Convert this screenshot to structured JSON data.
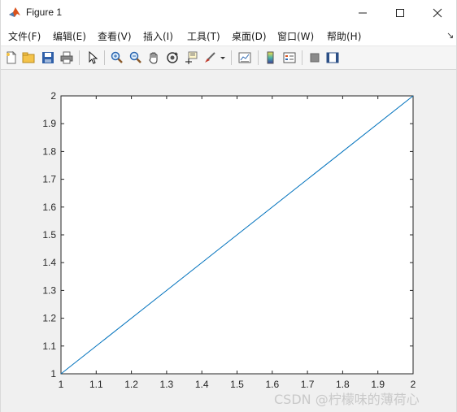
{
  "window": {
    "title": "Figure 1"
  },
  "menubar": {
    "items": [
      {
        "label": "文件(F)"
      },
      {
        "label": "编辑(E)"
      },
      {
        "label": "查看(V)"
      },
      {
        "label": "插入(I)"
      },
      {
        "label": "工具(T)"
      },
      {
        "label": "桌面(D)"
      },
      {
        "label": "窗口(W)"
      },
      {
        "label": "帮助(H)"
      }
    ]
  },
  "toolbar": {
    "buttons": [
      {
        "icon": "new-figure-icon"
      },
      {
        "icon": "open-file-icon"
      },
      {
        "icon": "save-icon"
      },
      {
        "icon": "print-icon"
      },
      {
        "icon": "edit-plot-arrow-icon"
      },
      {
        "icon": "zoom-in-icon"
      },
      {
        "icon": "zoom-out-icon"
      },
      {
        "icon": "pan-hand-icon"
      },
      {
        "icon": "rotate-3d-icon"
      },
      {
        "icon": "data-cursor-icon"
      },
      {
        "icon": "brush-icon"
      },
      {
        "icon": "link-plot-icon"
      },
      {
        "icon": "colorbar-icon"
      },
      {
        "icon": "legend-icon"
      },
      {
        "icon": "hide-plot-tools-icon"
      },
      {
        "icon": "show-plot-tools-icon"
      }
    ]
  },
  "colors": {
    "line": "#0072bd",
    "axes_bg": "#ffffff",
    "figure_bg": "#f0f0f0"
  },
  "chart_data": {
    "type": "line",
    "title": "",
    "xlabel": "",
    "ylabel": "",
    "xlim": [
      1,
      2
    ],
    "ylim": [
      1,
      2
    ],
    "xticks": [
      "1",
      "1.1",
      "1.2",
      "1.3",
      "1.4",
      "1.5",
      "1.6",
      "1.7",
      "1.8",
      "1.9",
      "2"
    ],
    "yticks": [
      "1",
      "1.1",
      "1.2",
      "1.3",
      "1.4",
      "1.5",
      "1.6",
      "1.7",
      "1.8",
      "1.9",
      "2"
    ],
    "grid": false,
    "series": [
      {
        "x": [
          1,
          2
        ],
        "y": [
          1,
          2
        ]
      }
    ]
  },
  "watermark": "CSDN @柠檬味的薄荷心"
}
